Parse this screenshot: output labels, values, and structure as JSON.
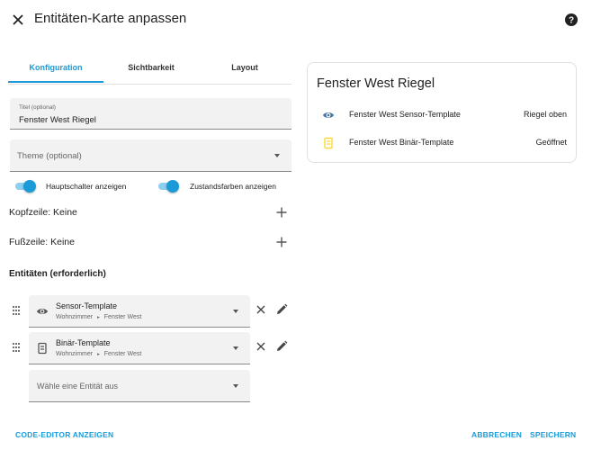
{
  "dialog": {
    "title": "Entitäten-Karte anpassen"
  },
  "tabs": [
    {
      "label": "Konfiguration",
      "active": true
    },
    {
      "label": "Sichtbarkeit",
      "active": false
    },
    {
      "label": "Layout",
      "active": false
    }
  ],
  "form": {
    "title_field": {
      "label": "Titel (optional)",
      "value": "Fenster West Riegel"
    },
    "theme_field": {
      "placeholder": "Theme (optional)"
    },
    "switches": [
      {
        "label": "Hauptschalter anzeigen",
        "on": true
      },
      {
        "label": "Zustandsfarben anzeigen",
        "on": true
      }
    ],
    "header_row": {
      "label": "Kopfzeile: Keine"
    },
    "footer_row": {
      "label": "Fußzeile: Keine"
    },
    "entities_title": "Entitäten (erforderlich)",
    "entities": [
      {
        "name": "Sensor-Template",
        "area": "Wohnzimmer",
        "device": "Fenster West",
        "separator": "▸",
        "icon": "eye-icon"
      },
      {
        "name": "Binär-Template",
        "area": "Wohnzimmer",
        "device": "Fenster West",
        "separator": "▸",
        "icon": "door-closed-icon"
      }
    ],
    "add_entity": {
      "placeholder": "Wähle eine Entität aus"
    }
  },
  "footer": {
    "code_editor_label": "CODE-EDITOR ANZEIGEN",
    "cancel_label": "ABBRECHEN",
    "save_label": "SPEICHERN"
  },
  "preview": {
    "title": "Fenster West Riegel",
    "rows": [
      {
        "name": "Fenster West Sensor-Template",
        "state": "Riegel oben",
        "icon": "eye-icon",
        "icon_color": "#44739e"
      },
      {
        "name": "Fenster West Binär-Template",
        "state": "Geöffnet",
        "icon": "door-open-icon",
        "icon_color": "#fdd835"
      }
    ]
  },
  "colors": {
    "accent": "#1a9bd8",
    "field_bg": "#f2f2f2"
  }
}
